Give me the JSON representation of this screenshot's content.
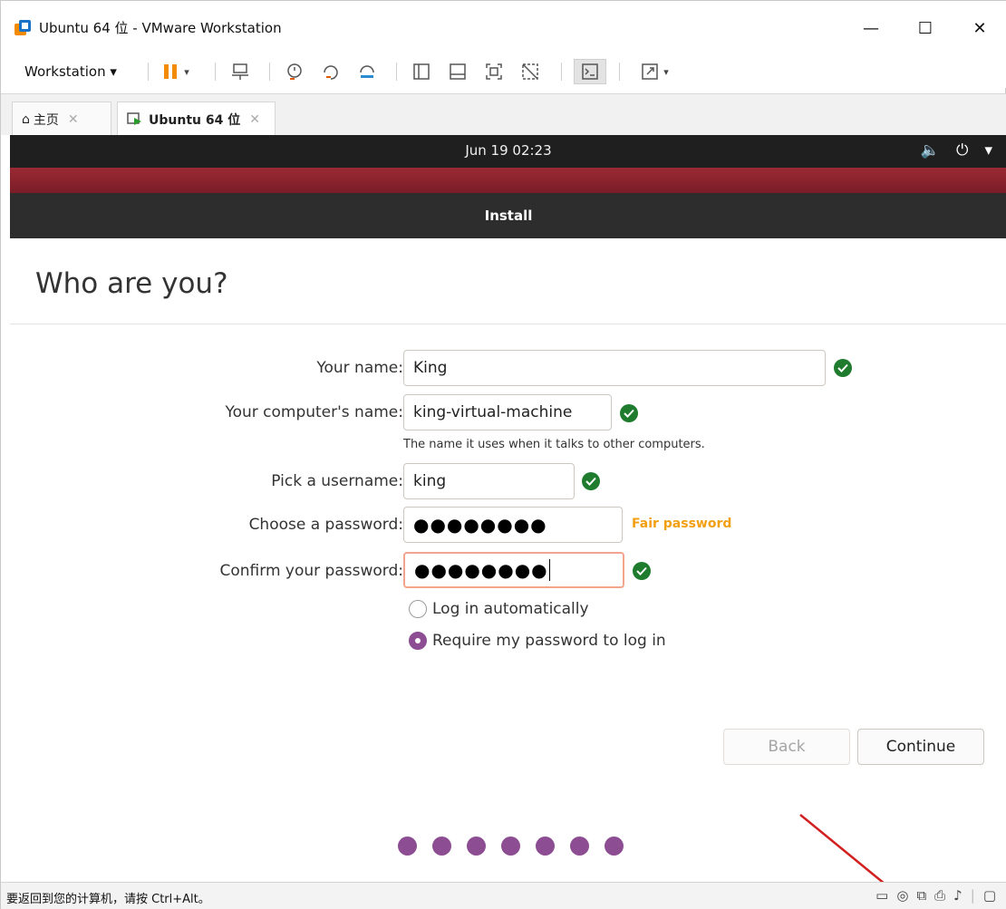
{
  "window": {
    "title": "Ubuntu 64 位 - VMware Workstation",
    "minimize": "—",
    "maximize": "☐",
    "close": "✕"
  },
  "toolbar": {
    "workstation_label": "Workstation ▾"
  },
  "tabs": [
    {
      "label": "主页",
      "close": "✕"
    },
    {
      "label": "Ubuntu 64 位",
      "close": "✕"
    }
  ],
  "guest_panel": {
    "clock": "Jun 19  02:23",
    "icons": [
      "volume-icon",
      "power-icon",
      "menu-caret-icon"
    ]
  },
  "installer": {
    "header": "Install",
    "heading": "Who are you?",
    "fields": {
      "name_label": "Your name:",
      "name_value": "King",
      "computer_label": "Your computer's name:",
      "computer_value": "king-virtual-machine",
      "computer_hint": "The name it uses when it talks to other computers.",
      "username_label": "Pick a username:",
      "username_value": "king",
      "password_label": "Choose a password:",
      "password_value": "●●●●●●●●",
      "password_strength": "Fair password",
      "confirm_label": "Confirm your password:",
      "confirm_value": "●●●●●●●●"
    },
    "options": {
      "auto_login": "Log in automatically",
      "require_password": "Require my password to log in",
      "selected": "require_password"
    },
    "buttons": {
      "back": "Back",
      "continue": "Continue"
    },
    "progress": {
      "total_steps": 7
    }
  },
  "statusbar": {
    "text": "要返回到您的计算机，请按 Ctrl+Alt。"
  },
  "colors": {
    "accent_purple": "#8c4d92",
    "check_green": "#1f7c2e",
    "strength_orange": "#f29f11",
    "arrow_red": "#d22020"
  }
}
